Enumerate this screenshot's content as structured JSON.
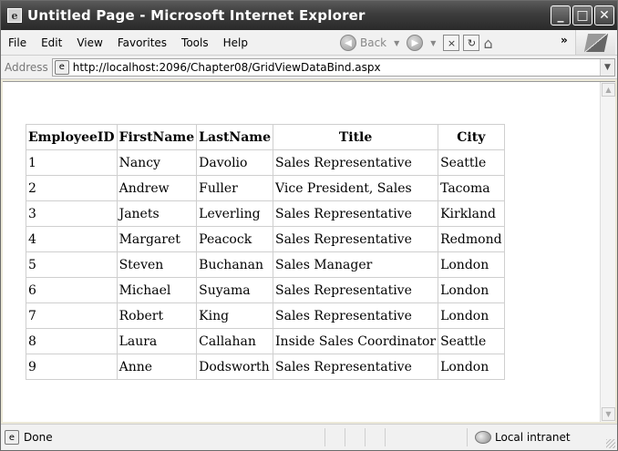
{
  "window": {
    "title": "Untitled Page - Microsoft Internet Explorer"
  },
  "title_buttons": {
    "minimize": "_",
    "maximize": "□",
    "close": "✕"
  },
  "menu": {
    "items": [
      {
        "label": "File"
      },
      {
        "label": "Edit"
      },
      {
        "label": "View"
      },
      {
        "label": "Favorites"
      },
      {
        "label": "Tools"
      },
      {
        "label": "Help"
      }
    ]
  },
  "toolbar": {
    "back_label": "Back",
    "more": "»"
  },
  "address": {
    "label": "Address",
    "url": "http://localhost:2096/Chapter08/GridViewDataBind.aspx"
  },
  "grid": {
    "headers": [
      "EmployeeID",
      "FirstName",
      "LastName",
      "Title",
      "City"
    ],
    "rows": [
      [
        "1",
        "Nancy",
        "Davolio",
        "Sales Representative",
        "Seattle"
      ],
      [
        "2",
        "Andrew",
        "Fuller",
        "Vice President, Sales",
        "Tacoma"
      ],
      [
        "3",
        "Janets",
        "Leverling",
        "Sales Representative",
        "Kirkland"
      ],
      [
        "4",
        "Margaret",
        "Peacock",
        "Sales Representative",
        "Redmond"
      ],
      [
        "5",
        "Steven",
        "Buchanan",
        "Sales Manager",
        "London"
      ],
      [
        "6",
        "Michael",
        "Suyama",
        "Sales Representative",
        "London"
      ],
      [
        "7",
        "Robert",
        "King",
        "Sales Representative",
        "London"
      ],
      [
        "8",
        "Laura",
        "Callahan",
        "Inside Sales Coordinator",
        "Seattle"
      ],
      [
        "9",
        "Anne",
        "Dodsworth",
        "Sales Representative",
        "London"
      ]
    ]
  },
  "status": {
    "text": "Done",
    "zone": "Local intranet"
  }
}
